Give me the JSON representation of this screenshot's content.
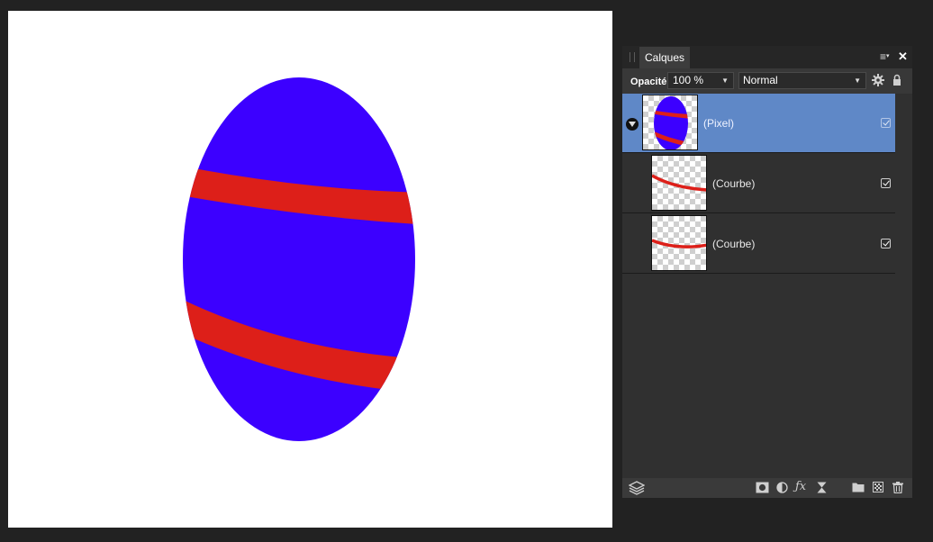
{
  "panel": {
    "tab_label": "Calques",
    "menu_icon": "menu-icon",
    "close_icon": "close-icon",
    "opacity_label": "Opacité:",
    "opacity_value": "100 %",
    "blend_mode": "Normal",
    "settings_icon": "gear-icon",
    "lock_icon": "lock-icon"
  },
  "layers": [
    {
      "name": "(Pixel)",
      "selected": true,
      "visible": true,
      "kind": "pixel"
    },
    {
      "name": "(Courbe)",
      "selected": false,
      "visible": true,
      "kind": "curve"
    },
    {
      "name": "(Courbe)",
      "selected": false,
      "visible": true,
      "kind": "curve"
    }
  ],
  "bottom_bar": {
    "icons": [
      "layers-stack-icon",
      "mask-icon",
      "adjustment-icon",
      "fx-icon",
      "live-filter-icon",
      "folder-icon",
      "checkerboard-icon",
      "trash-icon"
    ]
  },
  "colors": {
    "egg_fill": "#3c00ff",
    "stripe": "#dd1f19",
    "selection": "#5f88c7",
    "panel_bg": "#303030",
    "app_bg": "#222222"
  }
}
